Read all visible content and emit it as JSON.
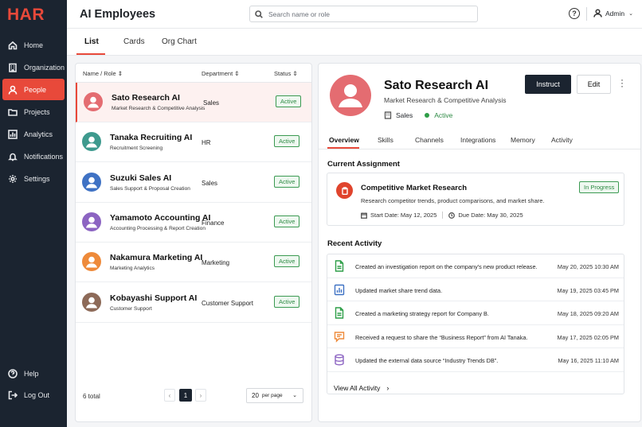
{
  "app": {
    "logo": "HAR"
  },
  "sidebar": {
    "items": [
      {
        "label": "Home",
        "icon": "home-icon"
      },
      {
        "label": "Organization",
        "icon": "building-icon"
      },
      {
        "label": "People",
        "icon": "person-icon",
        "active": true
      },
      {
        "label": "Projects",
        "icon": "folder-icon"
      },
      {
        "label": "Analytics",
        "icon": "chart-icon"
      },
      {
        "label": "Notifications",
        "icon": "bell-icon"
      },
      {
        "label": "Settings",
        "icon": "gear-icon"
      }
    ],
    "bottom": [
      {
        "label": "Help",
        "icon": "help-icon"
      },
      {
        "label": "Log Out",
        "icon": "logout-icon"
      }
    ]
  },
  "header": {
    "title": "AI Employees",
    "search_placeholder": "Search name or role",
    "help": "?",
    "user": "Admin"
  },
  "views": {
    "tabs": [
      "List",
      "Cards",
      "Org Chart"
    ],
    "active": "List"
  },
  "list": {
    "columns": {
      "name": "Name / Role",
      "department": "Department",
      "status": "Status"
    },
    "employees": [
      {
        "name": "Sato Research AI",
        "role": "Market Research & Competitive Analysis",
        "department": "Sales",
        "status": "Active",
        "avatar_color": "#e46c71",
        "selected": true
      },
      {
        "name": "Tanaka Recruiting AI",
        "role": "Recruitment Screening",
        "department": "HR",
        "status": "Active",
        "avatar_color": "#3e9a8e"
      },
      {
        "name": "Suzuki Sales AI",
        "role": "Sales Support & Proposal Creation",
        "department": "Sales",
        "status": "Active",
        "avatar_color": "#3f72c4"
      },
      {
        "name": "Yamamoto Accounting AI",
        "role": "Accounting Processing & Report Creation",
        "department": "Finance",
        "status": "Active",
        "avatar_color": "#8c64c2"
      },
      {
        "name": "Nakamura Marketing AI",
        "role": "Marketing Analytics",
        "department": "Marketing",
        "status": "Active",
        "avatar_color": "#ee8a3a"
      },
      {
        "name": "Kobayashi Support AI",
        "role": "Customer Support",
        "department": "Customer Support",
        "status": "Active",
        "avatar_color": "#8d6a58"
      }
    ],
    "total": "6 total",
    "prev": "‹",
    "page": "1",
    "next": "›",
    "per_page_value": "20",
    "per_page_label": "per page"
  },
  "detail": {
    "name": "Sato Research AI",
    "role": "Market Research & Competitive Analysis",
    "department": "Sales",
    "status": "Active",
    "instruct_label": "Instruct",
    "edit_label": "Edit",
    "tabs": [
      "Overview",
      "Skills",
      "Channels",
      "Integrations",
      "Memory",
      "Activity"
    ],
    "current_assignment_title": "Current Assignment",
    "assignment": {
      "title": "Competitive Market Research",
      "description": "Research competitor trends, product comparisons, and market share.",
      "start": "Start Date: May 12, 2025",
      "due": "Due Date: May 30, 2025",
      "status": "In Progress"
    },
    "recent_activity_title": "Recent Activity",
    "activities": [
      {
        "text": "Created an investigation report on the company's new product release.",
        "time": "May 20, 2025 10:30 AM",
        "icon": "document-icon",
        "color": "#2e9e48"
      },
      {
        "text": "Updated market share trend data.",
        "time": "May 19, 2025 03:45 PM",
        "icon": "bar-chart-icon",
        "color": "#3f72c4"
      },
      {
        "text": "Created a marketing strategy report for Company B.",
        "time": "May 18, 2025 09:20 AM",
        "icon": "document-icon",
        "color": "#2e9e48"
      },
      {
        "text": "Received a request to share the “Business Report” from AI Tanaka.",
        "time": "May 17, 2025 02:05 PM",
        "icon": "message-icon",
        "color": "#ee8a3a"
      },
      {
        "text": "Updated the external data source “Industry Trends DB”.",
        "time": "May 16, 2025 11:10 AM",
        "icon": "database-icon",
        "color": "#8c64c2"
      }
    ],
    "view_all": "View All Activity"
  }
}
